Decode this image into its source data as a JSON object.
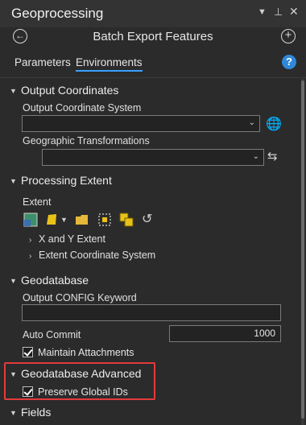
{
  "titlebar": {
    "title": "Geoprocessing",
    "menu_icon": "chevron-down-icon",
    "pin_icon": "pin-icon",
    "close_icon": "close-icon"
  },
  "header": {
    "back_icon": "back-arrow-icon",
    "tool_title": "Batch Export Features",
    "add_icon": "plus-icon"
  },
  "tabs": [
    {
      "label": "Parameters",
      "active": false
    },
    {
      "label": "Environments",
      "active": true
    }
  ],
  "help_label": "?",
  "sections": {
    "output_coordinates": {
      "title": "Output Coordinates",
      "ocs_label": "Output Coordinate System",
      "gt_label": "Geographic Transformations"
    },
    "processing_extent": {
      "title": "Processing Extent",
      "extent_label": "Extent",
      "items": [
        "X and Y Extent",
        "Extent Coordinate System"
      ]
    },
    "geodatabase": {
      "title": "Geodatabase",
      "config_label": "Output CONFIG Keyword",
      "auto_commit_label": "Auto Commit",
      "auto_commit_value": "1000",
      "maintain_label": "Maintain Attachments"
    },
    "geodatabase_advanced": {
      "title": "Geodatabase Advanced",
      "preserve_label": "Preserve Global IDs"
    },
    "fields": {
      "title": "Fields"
    }
  },
  "colors": {
    "background": "#2b2b2b",
    "accent": "#3aa0ff",
    "highlight": "#e23b3b"
  }
}
